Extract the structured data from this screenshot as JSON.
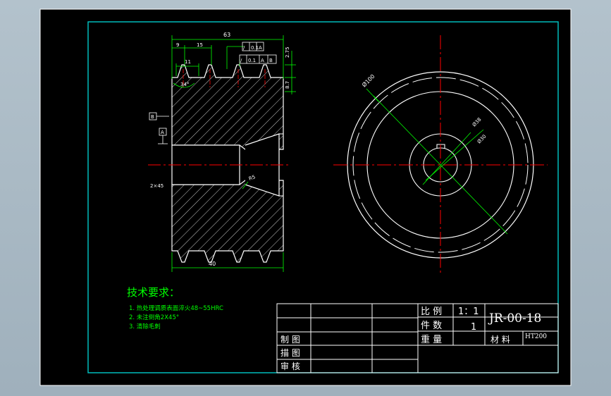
{
  "tech_req": {
    "title": "技术要求：",
    "items": [
      "1.  热处理调质表面淬火48~55HRC",
      "2.  未注倒角2X45°",
      "3.  清除毛刺"
    ]
  },
  "title_block": {
    "scale_label": "比 例",
    "scale_value": "1：1",
    "qty_label": "件 数",
    "qty_value": "1",
    "weight_label": "重 量",
    "material_label": "材 料",
    "material_value": "HT200",
    "drawing_no": "JR-00-18",
    "drawn_label": "制 图",
    "traced_label": "描 图",
    "checked_label": "审 核"
  },
  "dims": {
    "overall_width": "63",
    "d9": "9",
    "d15": "15",
    "d11": "11",
    "tol_runout": "0.1",
    "datum_a": "A",
    "datum_b": "B",
    "d275": "2.75",
    "d87": "8.7",
    "angle": "34°",
    "chamfer": "2×45",
    "radius": "R5",
    "hub_width": "40",
    "dia_outer": "Ø100",
    "dia_key": "Ø38",
    "dia_bore": "Ø30"
  },
  "colors": {
    "paper": "#000000",
    "frame": "#00c8c8",
    "geometry": "#ffffff",
    "dimension": "#00ff00",
    "center": "#ff0000",
    "title_text": "#ffffff",
    "note_text": "#00ff00"
  }
}
